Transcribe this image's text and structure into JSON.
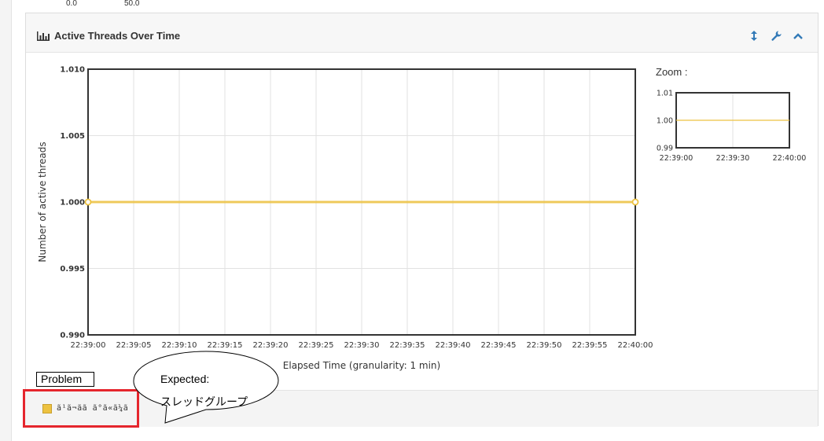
{
  "top_ticks": [
    "0.0",
    "50.0"
  ],
  "panel": {
    "title": "Active Threads Over Time",
    "title_icon": "bar-chart-icon",
    "tools": [
      {
        "name": "resize-vertical-icon",
        "glyph": "↕"
      },
      {
        "name": "wrench-icon",
        "glyph": "🔧"
      },
      {
        "name": "chevron-up-icon",
        "glyph": "︿"
      }
    ]
  },
  "chart_data": {
    "type": "line",
    "xlabel": "Elapsed Time (granularity: 1 min)",
    "ylabel": "Number of active threads",
    "ylim": [
      0.99,
      1.01
    ],
    "y_ticks": [
      "0.990",
      "0.995",
      "1.000",
      "1.005",
      "1.010"
    ],
    "x_ticks": [
      "22:39:00",
      "22:39:05",
      "22:39:10",
      "22:39:15",
      "22:39:20",
      "22:39:25",
      "22:39:30",
      "22:39:35",
      "22:39:40",
      "22:39:45",
      "22:39:50",
      "22:39:55",
      "22:40:00"
    ],
    "series": [
      {
        "color": "#edc240",
        "x": [
          "22:39:00",
          "22:40:00"
        ],
        "values": [
          1.0,
          1.0
        ]
      }
    ],
    "grid": true
  },
  "zoom": {
    "label": "Zoom :",
    "y_ticks": [
      "0.99",
      "1.00",
      "1.01"
    ],
    "x_ticks": [
      "22:39:00",
      "22:39:30",
      "22:40:00"
    ],
    "line_color": "#edc240"
  },
  "annotation": {
    "problem_label": "Problem",
    "legend_garbled": "ã¹ã¬ãã ã°ã«ã¼ã",
    "legend_color": "#edc240",
    "expected_line1": "Expected:",
    "expected_line2": "スレッドグループ",
    "highlight_color": "#e5262d"
  }
}
